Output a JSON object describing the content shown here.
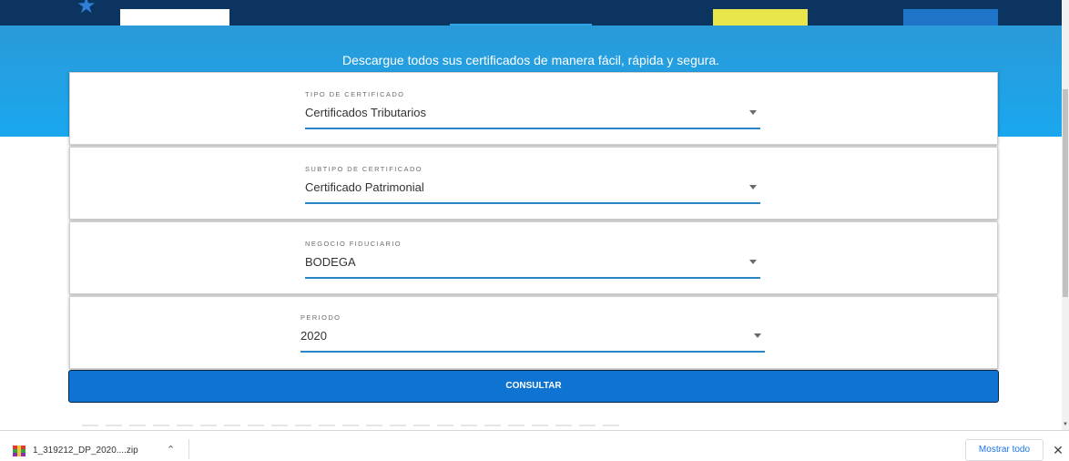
{
  "hero": {
    "tagline": "Descargue todos sus certificados de manera fácil, rápida y segura."
  },
  "form": {
    "fields": [
      {
        "label": "TIPO DE CERTIFICADO",
        "value": "Certificados Tributarios"
      },
      {
        "label": "SUBTIPO DE CERTIFICADO",
        "value": "Certificado Patrimonial"
      },
      {
        "label": "NEGOCIO FIDUCIARIO",
        "value": "BODEGA"
      },
      {
        "label": "PERIODO",
        "value": "2020"
      }
    ],
    "submit_label": "CONSULTAR"
  },
  "downloads": {
    "file_name": "1_319212_DP_2020....zip",
    "show_all_label": "Mostrar todo"
  },
  "icons": {
    "star": "star-logo-icon",
    "dropdown": "caret-down-icon",
    "file": "zip-archive-icon",
    "chevron": "chevron-up-icon",
    "close": "close-icon"
  },
  "colors": {
    "nav": "#0b3560",
    "hero_top": "#2a9ad8",
    "hero_bottom": "#1aa7ef",
    "accent_underline": "#2b86c6",
    "button": "#0f73d2",
    "nav_yellow": "#e8e64a",
    "link_blue": "#1a73e8"
  }
}
